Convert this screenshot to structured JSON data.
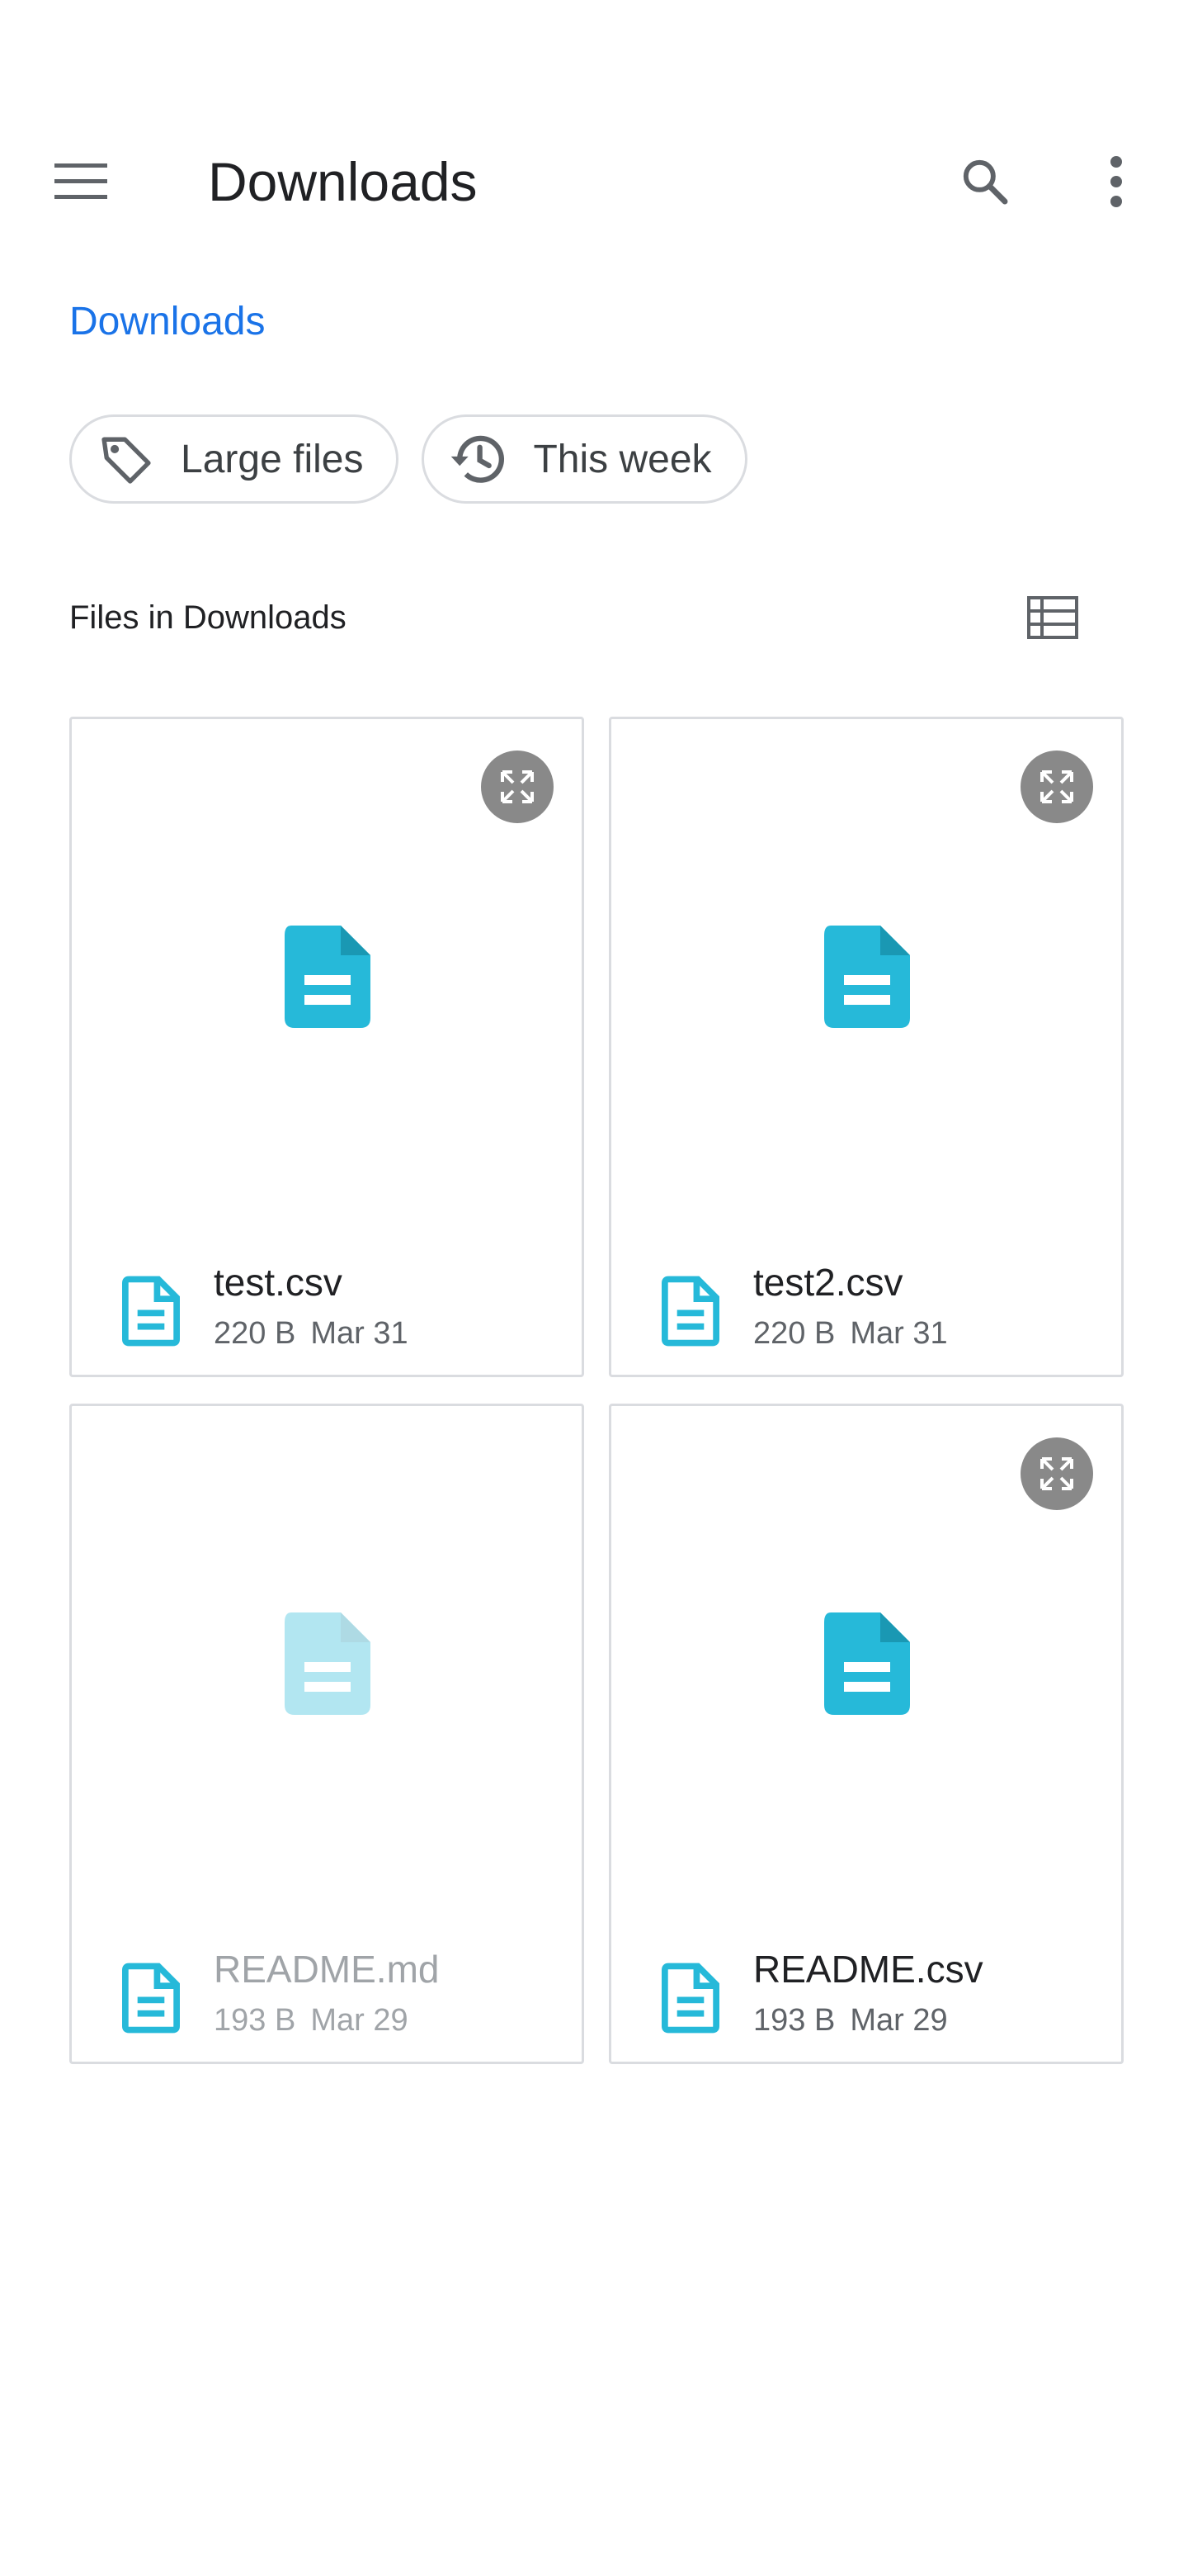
{
  "app_bar": {
    "title": "Downloads",
    "menu_icon": "hamburger-menu-icon",
    "search_icon": "search-icon",
    "more_icon": "more-vert-icon"
  },
  "breadcrumb": {
    "label": "Downloads"
  },
  "chips": [
    {
      "label": "Large files",
      "icon": "tag-icon"
    },
    {
      "label": "This week",
      "icon": "history-icon"
    }
  ],
  "section": {
    "title": "Files in Downloads",
    "view_toggle_icon": "list-view-icon"
  },
  "files": [
    {
      "name": "test.csv",
      "size": "220 B",
      "date": "Mar 31",
      "has_expand": true
    },
    {
      "name": "test2.csv",
      "size": "220 B",
      "date": "Mar 31",
      "has_expand": true
    },
    {
      "name": "README.md",
      "size": "193 B",
      "date": "Mar 29",
      "has_expand": false
    },
    {
      "name": "README.csv",
      "size": "193 B",
      "date": "Mar 29",
      "has_expand": true
    }
  ],
  "colors": {
    "accent": "#1a73e8",
    "file_icon": "#26b9d9",
    "chip_border": "#dadce0",
    "icon_gray": "#5f6368"
  }
}
